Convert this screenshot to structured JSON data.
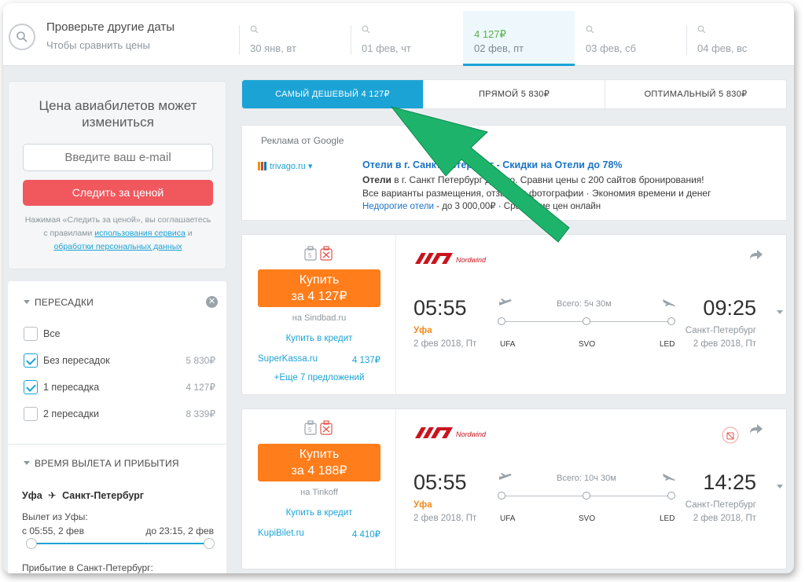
{
  "datebar": {
    "title": "Проверьте другие даты",
    "subtitle": "Чтобы сравнить цены",
    "dates": [
      {
        "label": "30 янв, вт",
        "price": ""
      },
      {
        "label": "01 фев, чт",
        "price": ""
      },
      {
        "label": "02 фев, пт",
        "price": "4 127₽"
      },
      {
        "label": "03 фев, сб",
        "price": ""
      },
      {
        "label": "04 фев, вс",
        "price": ""
      }
    ]
  },
  "subscribe": {
    "title": "Цена авиабилетов может изменить­ся",
    "title_line1": "Цена авиабилетов может",
    "title_line2": "измениться",
    "email_placeholder": "Введите ваш e-mail",
    "button": "Следить за ценой",
    "note_prefix": "Нажимая «Следить за ценой», вы соглашаетесь с правилами ",
    "note_link1": "использования сервиса",
    "note_and": " и ",
    "note_link2": "обработки персональных данных"
  },
  "filters": {
    "stops_header": "ПЕРЕСАДКИ",
    "stops": [
      {
        "label": "Все",
        "price": "",
        "checked": false
      },
      {
        "label": "Без пересадок",
        "price": "5 830₽",
        "checked": true
      },
      {
        "label": "1 пересадка",
        "price": "4 127₽",
        "checked": true
      },
      {
        "label": "2 пересадки",
        "price": "8 339₽",
        "checked": false
      }
    ],
    "time_header": "ВРЕМЯ ВЫЛЕТА И ПРИБЫТИЯ",
    "route_from": "Уфа",
    "route_to": "Санкт-Петербург",
    "departure_label": "Вылет из Уфы:",
    "departure_from": "с 05:55, 2 фев",
    "departure_to": "до 23:15, 2 фев",
    "arrival_label": "Прибытие в Санкт-Петербург:"
  },
  "sort_tabs": [
    {
      "label": "САМЫЙ ДЕШЕВЫЙ 4 127₽",
      "active": true
    },
    {
      "label": "ПРЯМОЙ 5 830₽",
      "active": false
    },
    {
      "label": "ОПТИМАЛЬНЫЙ 5 830₽",
      "active": false
    }
  ],
  "ad": {
    "source": "Реклама от Google",
    "logo": "trivago.ru ▾",
    "title": "Отели в г. Санкт Петербург - Скидки на Отели до 78%",
    "line1_bold": "Отели",
    "line1_rest": " в г. Санкт Петербург дорого. Сравни цены с 200 сайтов бронирования!",
    "line2": "Все варианты размещения, отзывы и фотографии · Экономия времени и денег",
    "line3_link": "Недорогие отели",
    "line3_rest": " - до 3 000,00₽ · Сравнение цен онлайн"
  },
  "cards": [
    {
      "buy_line1": "Купить",
      "buy_line2": "за 4 127₽",
      "source": "на Sindbad.ru",
      "credit": "Купить в кредит",
      "alt_name": "SuperKassa.ru",
      "alt_price": "4 137₽",
      "more": "+Еще 7 предложений",
      "airline": "Nordwind",
      "dep_time": "05:55",
      "dep_city": "Уфа",
      "dep_date": "2 фев 2018, Пт",
      "total": "Всего: 5ч 30м",
      "arr_time": "09:25",
      "arr_city": "Санкт-Петербург",
      "arr_date": "2 фев 2018, Пт",
      "iata": [
        "UFA",
        "SVO",
        "LED"
      ]
    },
    {
      "buy_line1": "Купить",
      "buy_line2": "за 4 188₽",
      "source": "на Tinkoff",
      "credit": "Купить в кредит",
      "alt_name": "KupiBilet.ru",
      "alt_price": "4 410₽",
      "more": "",
      "airline": "Nordwind",
      "dep_time": "05:55",
      "dep_city": "Уфа",
      "dep_date": "2 фев 2018, Пт",
      "total": "Всего: 10ч 30м",
      "arr_time": "14:25",
      "arr_city": "Санкт-Петербург",
      "arr_date": "2 фев 2018, Пт",
      "iata": [
        "UFA",
        "SVO",
        "LED"
      ]
    }
  ],
  "colors": {
    "accent": "#1ba3d6",
    "buy": "#ff7d1a",
    "track": "#f0585e",
    "price_green": "#59b04a",
    "annotation_arrow": "#1db36a"
  }
}
